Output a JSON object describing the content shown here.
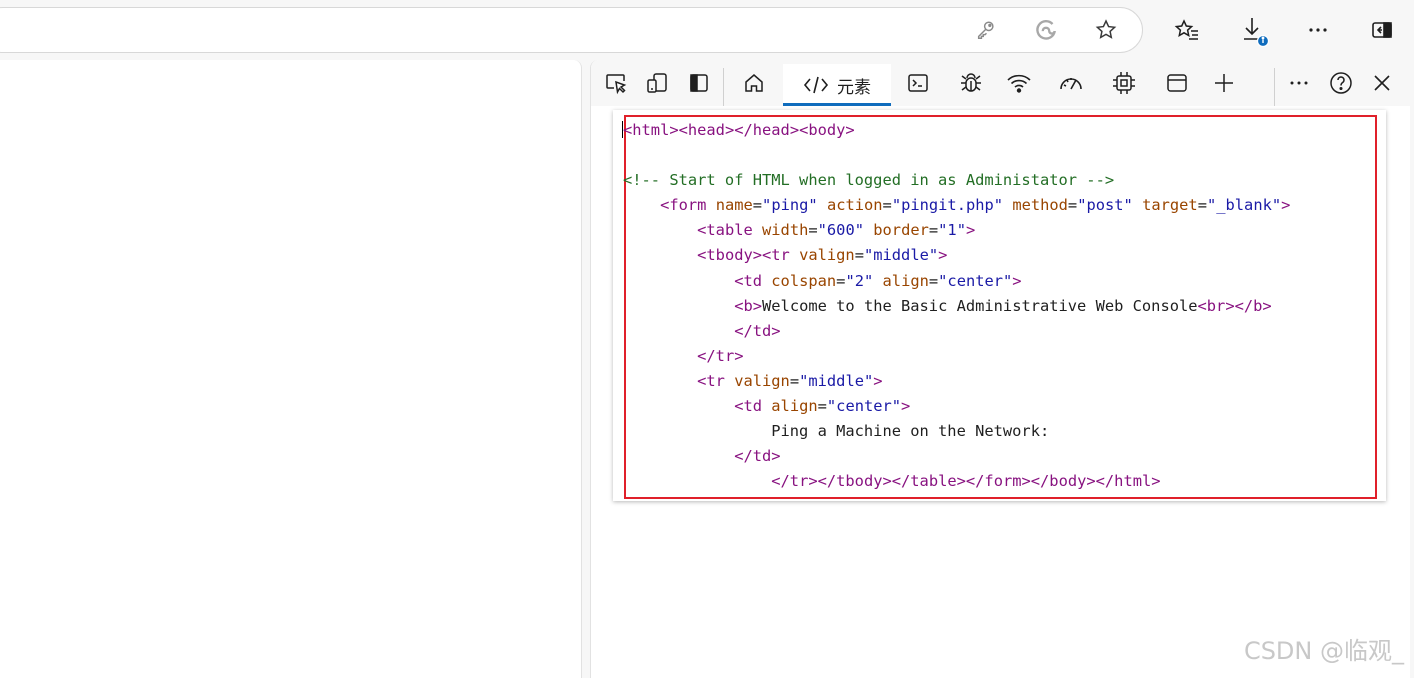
{
  "devtools": {
    "active_tab_label": "元素",
    "code_lines": [
      [
        {
          "c": "tg",
          "t": "<html>"
        },
        {
          "c": "tg",
          "t": "<head>"
        },
        {
          "c": "tg",
          "t": "</head>"
        },
        {
          "c": "tg",
          "t": "<body>"
        }
      ],
      [],
      [
        {
          "c": "cm",
          "t": "<!-- Start of HTML when logged in as Administator -->"
        }
      ],
      [
        {
          "c": "tx",
          "t": "    "
        },
        {
          "c": "tg",
          "t": "<form "
        },
        {
          "c": "at",
          "t": "name"
        },
        {
          "c": "tx",
          "t": "="
        },
        {
          "c": "av",
          "t": "\"ping\""
        },
        {
          "c": "tx",
          "t": " "
        },
        {
          "c": "at",
          "t": "action"
        },
        {
          "c": "tx",
          "t": "="
        },
        {
          "c": "av",
          "t": "\"pingit.php\""
        },
        {
          "c": "tx",
          "t": " "
        },
        {
          "c": "at",
          "t": "method"
        },
        {
          "c": "tx",
          "t": "="
        },
        {
          "c": "av",
          "t": "\"post\""
        },
        {
          "c": "tx",
          "t": " "
        },
        {
          "c": "at",
          "t": "target"
        },
        {
          "c": "tx",
          "t": "="
        },
        {
          "c": "av",
          "t": "\"_blank\""
        },
        {
          "c": "tg",
          "t": ">"
        }
      ],
      [
        {
          "c": "tx",
          "t": "        "
        },
        {
          "c": "tg",
          "t": "<table "
        },
        {
          "c": "at",
          "t": "width"
        },
        {
          "c": "tx",
          "t": "="
        },
        {
          "c": "av",
          "t": "\"600\""
        },
        {
          "c": "tx",
          "t": " "
        },
        {
          "c": "at",
          "t": "border"
        },
        {
          "c": "tx",
          "t": "="
        },
        {
          "c": "av",
          "t": "\"1\""
        },
        {
          "c": "tg",
          "t": ">"
        }
      ],
      [
        {
          "c": "tx",
          "t": "        "
        },
        {
          "c": "tg",
          "t": "<tbody>"
        },
        {
          "c": "tg",
          "t": "<tr "
        },
        {
          "c": "at",
          "t": "valign"
        },
        {
          "c": "tx",
          "t": "="
        },
        {
          "c": "av",
          "t": "\"middle\""
        },
        {
          "c": "tg",
          "t": ">"
        }
      ],
      [
        {
          "c": "tx",
          "t": "            "
        },
        {
          "c": "tg",
          "t": "<td "
        },
        {
          "c": "at",
          "t": "colspan"
        },
        {
          "c": "tx",
          "t": "="
        },
        {
          "c": "av",
          "t": "\"2\""
        },
        {
          "c": "tx",
          "t": " "
        },
        {
          "c": "at",
          "t": "align"
        },
        {
          "c": "tx",
          "t": "="
        },
        {
          "c": "av",
          "t": "\"center\""
        },
        {
          "c": "tg",
          "t": ">"
        }
      ],
      [
        {
          "c": "tx",
          "t": "            "
        },
        {
          "c": "tg",
          "t": "<b>"
        },
        {
          "c": "tx",
          "t": "Welcome to the Basic Administrative Web Console"
        },
        {
          "c": "tg",
          "t": "<br>"
        },
        {
          "c": "tg",
          "t": "</b>"
        }
      ],
      [
        {
          "c": "tx",
          "t": "            "
        },
        {
          "c": "tg",
          "t": "</td>"
        }
      ],
      [
        {
          "c": "tx",
          "t": "        "
        },
        {
          "c": "tg",
          "t": "</tr>"
        }
      ],
      [
        {
          "c": "tx",
          "t": "        "
        },
        {
          "c": "tg",
          "t": "<tr "
        },
        {
          "c": "at",
          "t": "valign"
        },
        {
          "c": "tx",
          "t": "="
        },
        {
          "c": "av",
          "t": "\"middle\""
        },
        {
          "c": "tg",
          "t": ">"
        }
      ],
      [
        {
          "c": "tx",
          "t": "            "
        },
        {
          "c": "tg",
          "t": "<td "
        },
        {
          "c": "at",
          "t": "align"
        },
        {
          "c": "tx",
          "t": "="
        },
        {
          "c": "av",
          "t": "\"center\""
        },
        {
          "c": "tg",
          "t": ">"
        }
      ],
      [
        {
          "c": "tx",
          "t": "                Ping a Machine on the Network:"
        }
      ],
      [
        {
          "c": "tx",
          "t": "            "
        },
        {
          "c": "tg",
          "t": "</td>"
        }
      ],
      [
        {
          "c": "tx",
          "t": "                "
        },
        {
          "c": "tg",
          "t": "</tr>"
        },
        {
          "c": "tg",
          "t": "</tbody>"
        },
        {
          "c": "tg",
          "t": "</table>"
        },
        {
          "c": "tg",
          "t": "</form>"
        },
        {
          "c": "tg",
          "t": "</body>"
        },
        {
          "c": "tg",
          "t": "</html>"
        }
      ]
    ]
  },
  "icons": {
    "browser": [
      "key-icon",
      "edge-copilot-icon",
      "star-add-favorite-icon",
      "favorites-icon",
      "downloads-icon",
      "more-options-icon",
      "sidebar-toggle-icon"
    ],
    "devtools": [
      "inspect-element-icon",
      "device-emulation-icon",
      "dock-side-icon",
      "welcome-home-icon",
      "elements-code-icon",
      "console-icon",
      "sources-debug-icon",
      "network-icon",
      "performance-icon",
      "memory-icon",
      "application-icon",
      "more-tools-icon",
      "more-options-icon",
      "help-icon",
      "close-icon"
    ]
  },
  "colors": {
    "highlight_border": "#e0202a",
    "tag": "#881280",
    "attribute_name": "#994500",
    "attribute_value": "#1a1aa6",
    "comment": "#236e25",
    "active_tab_underline": "#0f6cbd",
    "download_badge": "#0f6cbd"
  },
  "watermark": "CSDN @临观_"
}
